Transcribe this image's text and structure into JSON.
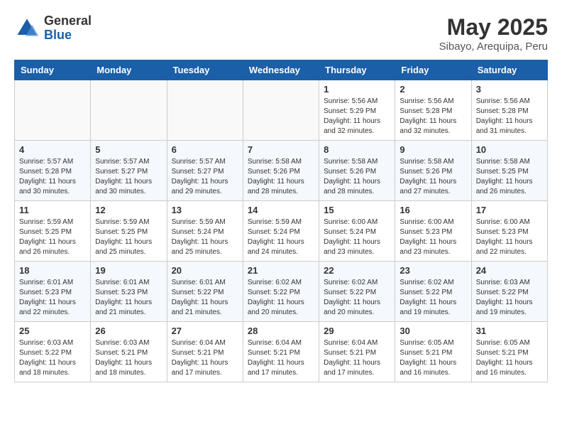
{
  "logo": {
    "general": "General",
    "blue": "Blue"
  },
  "title": "May 2025",
  "subtitle": "Sibayo, Arequipa, Peru",
  "headers": [
    "Sunday",
    "Monday",
    "Tuesday",
    "Wednesday",
    "Thursday",
    "Friday",
    "Saturday"
  ],
  "weeks": [
    [
      {
        "day": "",
        "content": ""
      },
      {
        "day": "",
        "content": ""
      },
      {
        "day": "",
        "content": ""
      },
      {
        "day": "",
        "content": ""
      },
      {
        "day": "1",
        "content": "Sunrise: 5:56 AM\nSunset: 5:29 PM\nDaylight: 11 hours\nand 32 minutes."
      },
      {
        "day": "2",
        "content": "Sunrise: 5:56 AM\nSunset: 5:28 PM\nDaylight: 11 hours\nand 32 minutes."
      },
      {
        "day": "3",
        "content": "Sunrise: 5:56 AM\nSunset: 5:28 PM\nDaylight: 11 hours\nand 31 minutes."
      }
    ],
    [
      {
        "day": "4",
        "content": "Sunrise: 5:57 AM\nSunset: 5:28 PM\nDaylight: 11 hours\nand 30 minutes."
      },
      {
        "day": "5",
        "content": "Sunrise: 5:57 AM\nSunset: 5:27 PM\nDaylight: 11 hours\nand 30 minutes."
      },
      {
        "day": "6",
        "content": "Sunrise: 5:57 AM\nSunset: 5:27 PM\nDaylight: 11 hours\nand 29 minutes."
      },
      {
        "day": "7",
        "content": "Sunrise: 5:58 AM\nSunset: 5:26 PM\nDaylight: 11 hours\nand 28 minutes."
      },
      {
        "day": "8",
        "content": "Sunrise: 5:58 AM\nSunset: 5:26 PM\nDaylight: 11 hours\nand 28 minutes."
      },
      {
        "day": "9",
        "content": "Sunrise: 5:58 AM\nSunset: 5:26 PM\nDaylight: 11 hours\nand 27 minutes."
      },
      {
        "day": "10",
        "content": "Sunrise: 5:58 AM\nSunset: 5:25 PM\nDaylight: 11 hours\nand 26 minutes."
      }
    ],
    [
      {
        "day": "11",
        "content": "Sunrise: 5:59 AM\nSunset: 5:25 PM\nDaylight: 11 hours\nand 26 minutes."
      },
      {
        "day": "12",
        "content": "Sunrise: 5:59 AM\nSunset: 5:25 PM\nDaylight: 11 hours\nand 25 minutes."
      },
      {
        "day": "13",
        "content": "Sunrise: 5:59 AM\nSunset: 5:24 PM\nDaylight: 11 hours\nand 25 minutes."
      },
      {
        "day": "14",
        "content": "Sunrise: 5:59 AM\nSunset: 5:24 PM\nDaylight: 11 hours\nand 24 minutes."
      },
      {
        "day": "15",
        "content": "Sunrise: 6:00 AM\nSunset: 5:24 PM\nDaylight: 11 hours\nand 23 minutes."
      },
      {
        "day": "16",
        "content": "Sunrise: 6:00 AM\nSunset: 5:23 PM\nDaylight: 11 hours\nand 23 minutes."
      },
      {
        "day": "17",
        "content": "Sunrise: 6:00 AM\nSunset: 5:23 PM\nDaylight: 11 hours\nand 22 minutes."
      }
    ],
    [
      {
        "day": "18",
        "content": "Sunrise: 6:01 AM\nSunset: 5:23 PM\nDaylight: 11 hours\nand 22 minutes."
      },
      {
        "day": "19",
        "content": "Sunrise: 6:01 AM\nSunset: 5:23 PM\nDaylight: 11 hours\nand 21 minutes."
      },
      {
        "day": "20",
        "content": "Sunrise: 6:01 AM\nSunset: 5:22 PM\nDaylight: 11 hours\nand 21 minutes."
      },
      {
        "day": "21",
        "content": "Sunrise: 6:02 AM\nSunset: 5:22 PM\nDaylight: 11 hours\nand 20 minutes."
      },
      {
        "day": "22",
        "content": "Sunrise: 6:02 AM\nSunset: 5:22 PM\nDaylight: 11 hours\nand 20 minutes."
      },
      {
        "day": "23",
        "content": "Sunrise: 6:02 AM\nSunset: 5:22 PM\nDaylight: 11 hours\nand 19 minutes."
      },
      {
        "day": "24",
        "content": "Sunrise: 6:03 AM\nSunset: 5:22 PM\nDaylight: 11 hours\nand 19 minutes."
      }
    ],
    [
      {
        "day": "25",
        "content": "Sunrise: 6:03 AM\nSunset: 5:22 PM\nDaylight: 11 hours\nand 18 minutes."
      },
      {
        "day": "26",
        "content": "Sunrise: 6:03 AM\nSunset: 5:21 PM\nDaylight: 11 hours\nand 18 minutes."
      },
      {
        "day": "27",
        "content": "Sunrise: 6:04 AM\nSunset: 5:21 PM\nDaylight: 11 hours\nand 17 minutes."
      },
      {
        "day": "28",
        "content": "Sunrise: 6:04 AM\nSunset: 5:21 PM\nDaylight: 11 hours\nand 17 minutes."
      },
      {
        "day": "29",
        "content": "Sunrise: 6:04 AM\nSunset: 5:21 PM\nDaylight: 11 hours\nand 17 minutes."
      },
      {
        "day": "30",
        "content": "Sunrise: 6:05 AM\nSunset: 5:21 PM\nDaylight: 11 hours\nand 16 minutes."
      },
      {
        "day": "31",
        "content": "Sunrise: 6:05 AM\nSunset: 5:21 PM\nDaylight: 11 hours\nand 16 minutes."
      }
    ]
  ]
}
